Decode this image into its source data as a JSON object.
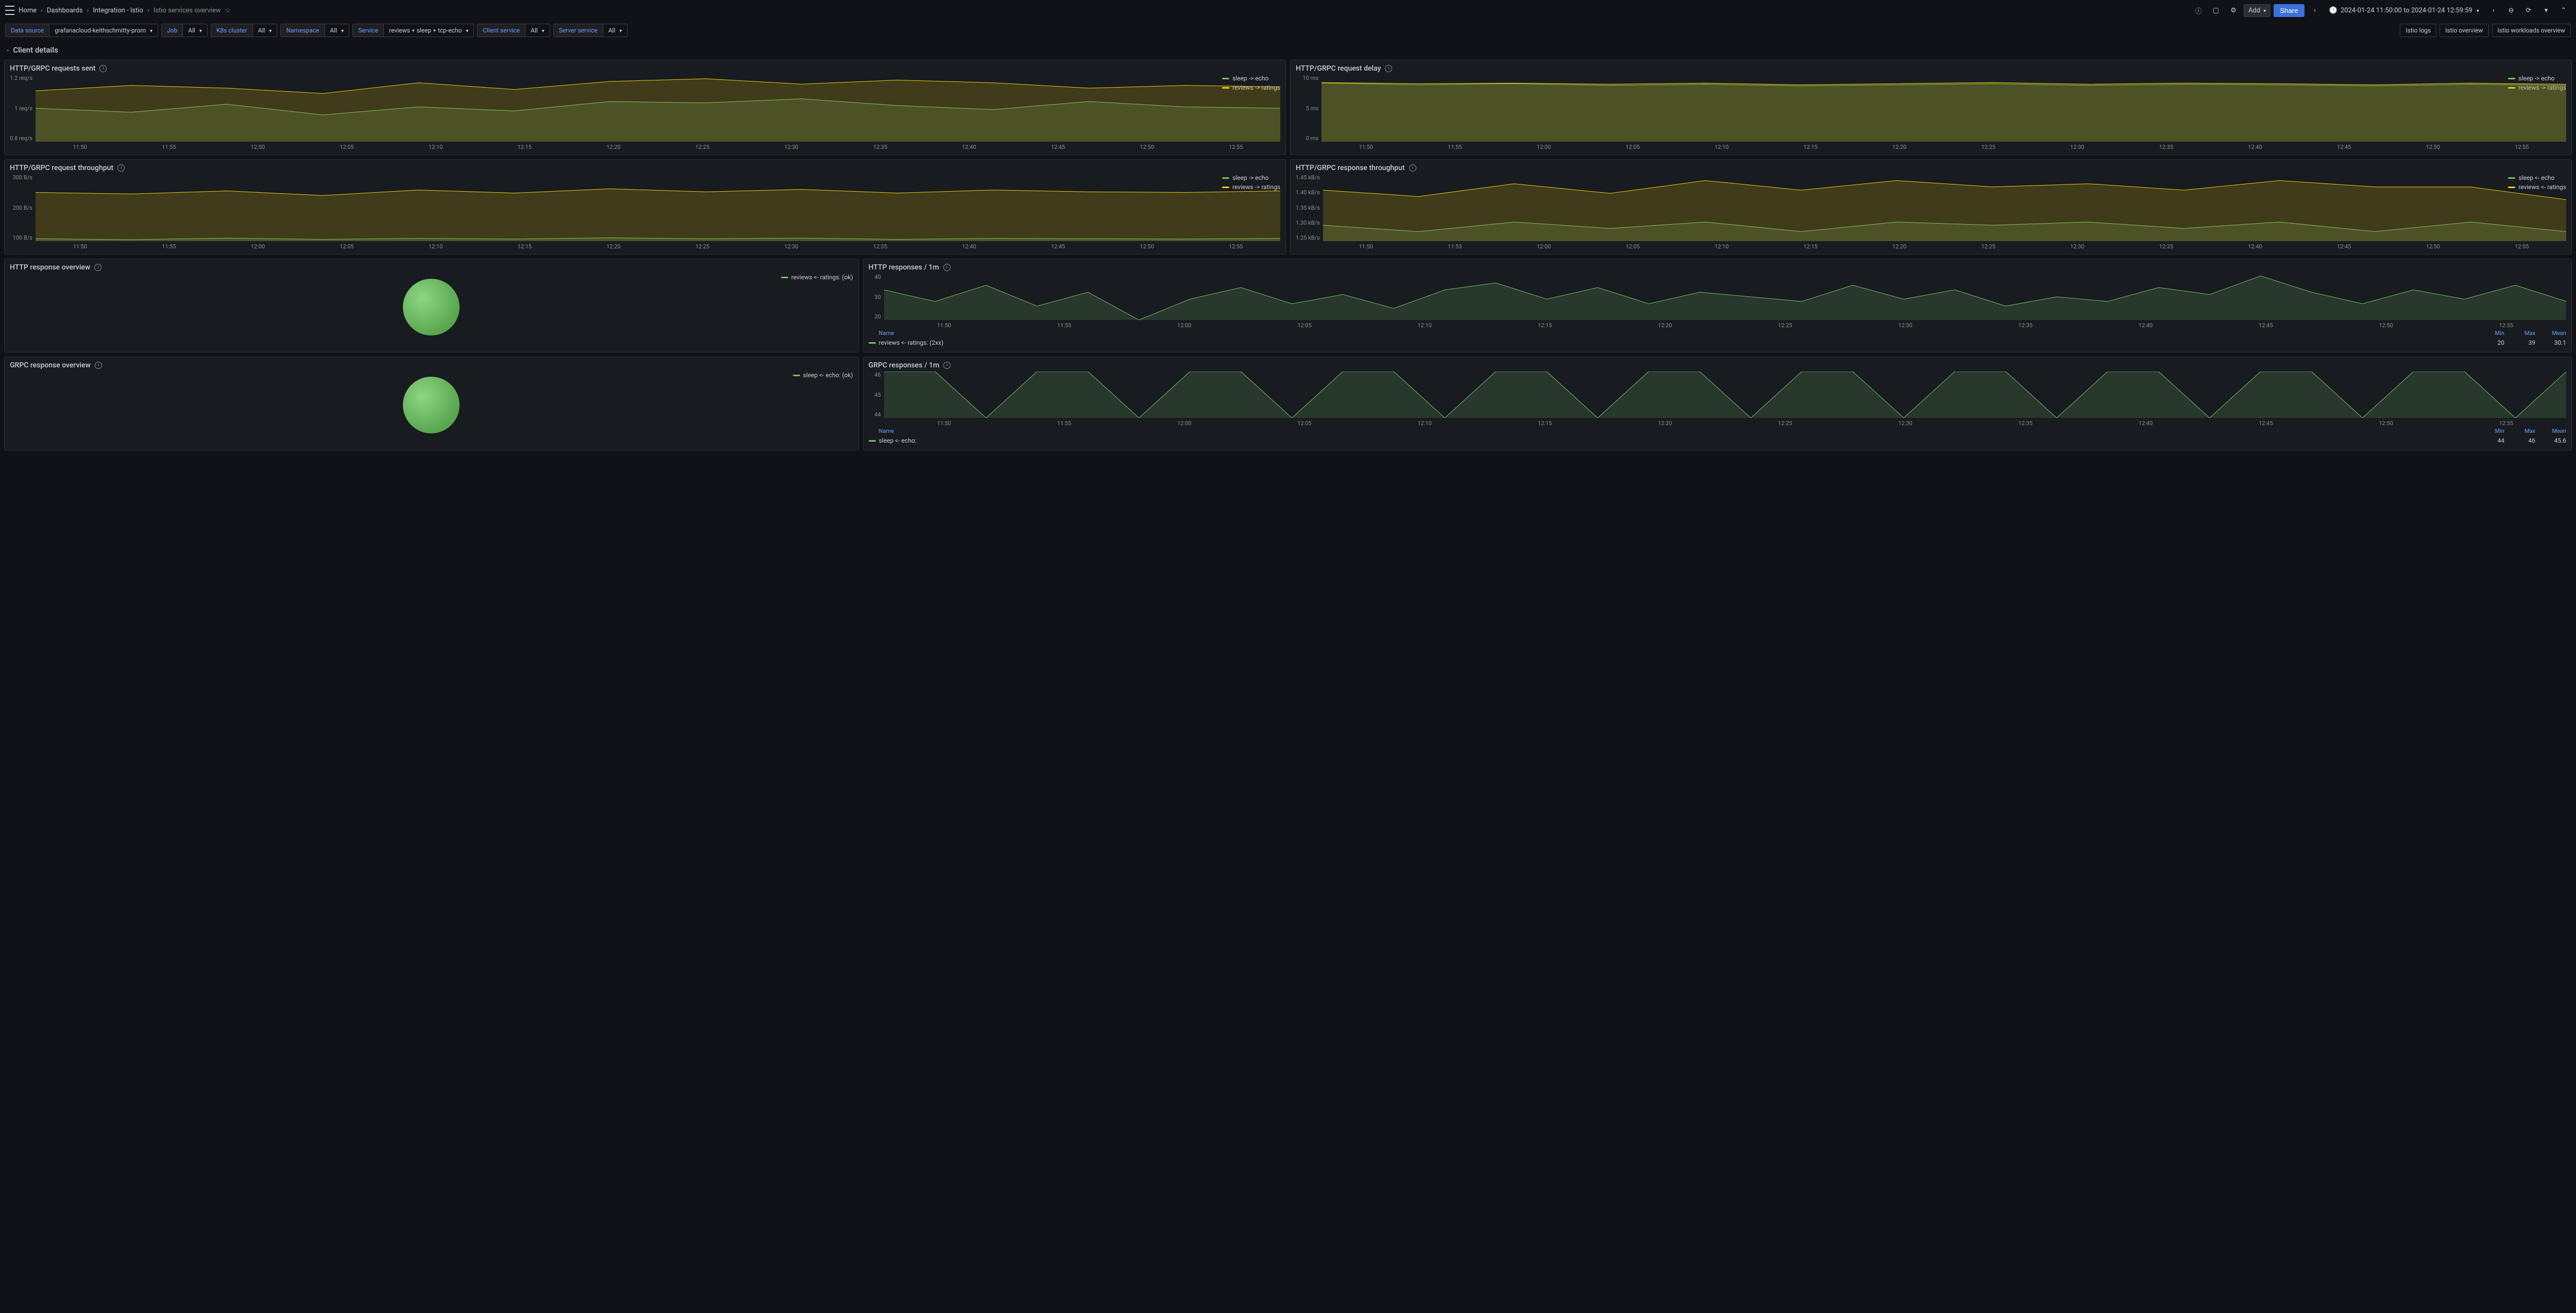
{
  "breadcrumb": {
    "home": "Home",
    "dashboards": "Dashboards",
    "integration": "Integration - Istio",
    "current": "Istio services overview"
  },
  "toolbar": {
    "add_label": "Add",
    "share_label": "Share",
    "time_range": "2024-01-24 11:50:00 to 2024-01-24 12:59:59"
  },
  "filters": {
    "data_source_label": "Data source",
    "data_source_value": "grafanacloud-keithschmitty-prom",
    "job_label": "Job",
    "job_value": "All",
    "k8s_label": "K8s cluster",
    "k8s_value": "All",
    "namespace_label": "Namespace",
    "namespace_value": "All",
    "service_label": "Service",
    "service_value": "reviews + sleep + tcp-echo",
    "client_service_label": "Client service",
    "client_service_value": "All",
    "server_service_label": "Server service",
    "server_service_value": "All"
  },
  "links": {
    "istio_logs": "Istio logs",
    "istio_overview": "Istio overview",
    "istio_workloads": "Istio workloads overview"
  },
  "section": {
    "title": "Client details"
  },
  "panels": {
    "requests_sent": {
      "title": "HTTP/GRPC requests sent",
      "legend": [
        "sleep -> echo",
        "reviews -> ratings"
      ]
    },
    "request_delay": {
      "title": "HTTP/GRPC request delay",
      "legend": [
        "sleep -> echo",
        "reviews -> ratings"
      ]
    },
    "request_throughput": {
      "title": "HTTP/GRPC request throughput",
      "legend": [
        "sleep -> echo",
        "reviews -> ratings"
      ]
    },
    "response_throughput": {
      "title": "HTTP/GRPC response throughput",
      "legend": [
        "sleep <- echo",
        "reviews <- ratings"
      ]
    },
    "http_response_overview": {
      "title": "HTTP response overview",
      "legend": "reviews <- ratings: (ok)"
    },
    "http_responses_1m": {
      "title": "HTTP responses / 1m",
      "series_name": "reviews <- ratings: (2xx)",
      "stats": {
        "min": "20",
        "max": "39",
        "mean": "30.1"
      }
    },
    "grpc_response_overview": {
      "title": "GRPC response overview",
      "legend": "sleep <- echo: (ok)"
    },
    "grpc_responses_1m": {
      "title": "GRPC responses / 1m",
      "series_name": "sleep <- echo:",
      "stats": {
        "min": "44",
        "max": "46",
        "mean": "45.6"
      }
    }
  },
  "stats_headers": {
    "name": "Name",
    "min": "Min",
    "max": "Max",
    "mean": "Mean"
  },
  "chart_data": [
    {
      "type": "area",
      "panel": "requests_sent",
      "x_ticks": [
        "11:50",
        "11:55",
        "12:00",
        "12:05",
        "12:10",
        "12:15",
        "12:20",
        "12:25",
        "12:30",
        "12:35",
        "12:40",
        "12:45",
        "12:50",
        "12:55"
      ],
      "y_ticks": [
        "0.8 req/s",
        "1 req/s",
        "1.2 req/s"
      ],
      "ylim": [
        0.8,
        1.3
      ],
      "series": [
        {
          "name": "sleep -> echo",
          "color": "#73bf69",
          "values": [
            1.05,
            1.02,
            1.08,
            1.0,
            1.06,
            1.03,
            1.1,
            1.09,
            1.12,
            1.07,
            1.04,
            1.1,
            1.06,
            1.05
          ]
        },
        {
          "name": "reviews -> ratings",
          "color": "#f2cc0c",
          "values": [
            1.18,
            1.22,
            1.2,
            1.16,
            1.24,
            1.19,
            1.25,
            1.27,
            1.23,
            1.26,
            1.24,
            1.2,
            1.22,
            1.21
          ]
        }
      ]
    },
    {
      "type": "area",
      "panel": "request_delay",
      "x_ticks": [
        "11:50",
        "11:55",
        "12:00",
        "12:05",
        "12:10",
        "12:15",
        "12:20",
        "12:25",
        "12:30",
        "12:35",
        "12:40",
        "12:45",
        "12:50",
        "12:55"
      ],
      "y_ticks": [
        "0 ms",
        "5 ms",
        "10 ms"
      ],
      "ylim": [
        0,
        12
      ],
      "series": [
        {
          "name": "sleep -> echo",
          "color": "#73bf69",
          "values": [
            10.5,
            10.2,
            10.4,
            10.1,
            10.3,
            10.0,
            10.2,
            10.4,
            10.1,
            10.3,
            10.2,
            10.0,
            10.3,
            10.1
          ]
        },
        {
          "name": "reviews -> ratings",
          "color": "#f2cc0c",
          "values": [
            10.6,
            10.4,
            10.5,
            10.3,
            10.5,
            10.2,
            10.4,
            10.6,
            10.3,
            10.5,
            10.4,
            10.2,
            10.5,
            10.3
          ]
        }
      ]
    },
    {
      "type": "area",
      "panel": "request_throughput",
      "x_ticks": [
        "11:50",
        "11:55",
        "12:00",
        "12:05",
        "12:10",
        "12:15",
        "12:20",
        "12:25",
        "12:30",
        "12:35",
        "12:40",
        "12:45",
        "12:50",
        "12:55"
      ],
      "y_ticks": [
        "100 B/s",
        "200 B/s",
        "300 B/s"
      ],
      "ylim": [
        100,
        320
      ],
      "series": [
        {
          "name": "sleep -> echo",
          "color": "#73bf69",
          "values": [
            108,
            105,
            110,
            106,
            109,
            107,
            111,
            108,
            110,
            106,
            109,
            108,
            107,
            109
          ]
        },
        {
          "name": "reviews -> ratings",
          "color": "#f2cc0c",
          "values": [
            260,
            255,
            265,
            250,
            268,
            258,
            272,
            262,
            270,
            258,
            268,
            262,
            260,
            265
          ]
        }
      ]
    },
    {
      "type": "area",
      "panel": "response_throughput",
      "x_ticks": [
        "11:50",
        "11:55",
        "12:00",
        "12:05",
        "12:10",
        "12:15",
        "12:20",
        "12:25",
        "12:30",
        "12:35",
        "12:40",
        "12:45",
        "12:50",
        "12:55"
      ],
      "y_ticks": [
        "1.25 kB/s",
        "1.30 kB/s",
        "1.35 kB/s",
        "1.40 kB/s",
        "1.45 kB/s"
      ],
      "ylim": [
        1.25,
        1.46
      ],
      "series": [
        {
          "name": "sleep <- echo",
          "color": "#73bf69",
          "values": [
            1.3,
            1.28,
            1.31,
            1.29,
            1.31,
            1.28,
            1.31,
            1.3,
            1.31,
            1.29,
            1.31,
            1.28,
            1.31,
            1.28
          ]
        },
        {
          "name": "reviews <- ratings",
          "color": "#f2cc0c",
          "values": [
            1.41,
            1.39,
            1.43,
            1.4,
            1.44,
            1.41,
            1.44,
            1.42,
            1.43,
            1.41,
            1.44,
            1.42,
            1.42,
            1.38
          ]
        }
      ]
    },
    {
      "type": "pie",
      "panel": "http_response_overview",
      "series": [
        {
          "name": "reviews <- ratings: (ok)",
          "value": 100,
          "color": "#73bf69"
        }
      ]
    },
    {
      "type": "area",
      "panel": "http_responses_1m",
      "x_ticks": [
        "11:50",
        "11:55",
        "12:00",
        "12:05",
        "12:10",
        "12:15",
        "12:20",
        "12:25",
        "12:30",
        "12:35",
        "12:40",
        "12:45",
        "12:50",
        "12:55"
      ],
      "y_ticks": [
        "20",
        "30",
        "40"
      ],
      "ylim": [
        20,
        40
      ],
      "series": [
        {
          "name": "reviews <- ratings: (2xx)",
          "color": "#73bf69",
          "values": [
            33,
            28,
            35,
            26,
            32,
            20,
            29,
            34,
            27,
            31,
            25,
            33,
            36,
            29,
            34,
            27,
            32,
            30,
            28,
            35,
            29,
            33,
            26,
            30,
            28,
            34,
            31,
            39,
            32,
            27,
            33,
            29,
            35,
            28
          ]
        }
      ]
    },
    {
      "type": "pie",
      "panel": "grpc_response_overview",
      "series": [
        {
          "name": "sleep <- echo: (ok)",
          "value": 100,
          "color": "#73bf69"
        }
      ]
    },
    {
      "type": "area",
      "panel": "grpc_responses_1m",
      "x_ticks": [
        "11:50",
        "11:55",
        "12:00",
        "12:05",
        "12:10",
        "12:15",
        "12:20",
        "12:25",
        "12:30",
        "12:35",
        "12:40",
        "12:45",
        "12:50",
        "12:55"
      ],
      "y_ticks": [
        "44",
        "45",
        "46"
      ],
      "ylim": [
        44,
        46
      ],
      "series": [
        {
          "name": "sleep <- echo:",
          "color": "#73bf69",
          "values": [
            46,
            46,
            44,
            46,
            46,
            44,
            46,
            46,
            44,
            46,
            46,
            44,
            46,
            46,
            44,
            46,
            46,
            44,
            46,
            46,
            44,
            46,
            46,
            44,
            46,
            46,
            44,
            46,
            46,
            44,
            46,
            46,
            44,
            46
          ]
        }
      ]
    }
  ]
}
